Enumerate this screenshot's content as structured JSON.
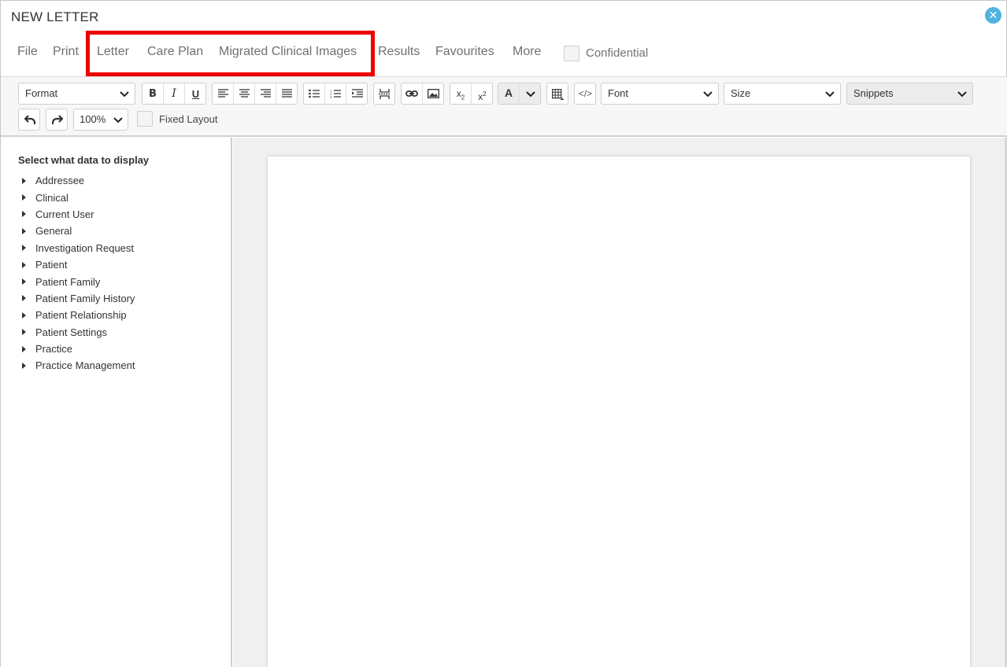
{
  "window": {
    "title": "NEW LETTER",
    "close_icon": "close-circle-icon"
  },
  "menu": {
    "items": [
      {
        "label": "File"
      },
      {
        "label": "Print"
      },
      {
        "label": "Letter"
      },
      {
        "label": "Care Plan"
      },
      {
        "label": "Migrated Clinical Images"
      },
      {
        "label": "Results"
      },
      {
        "label": "Favourites"
      },
      {
        "label": "More"
      }
    ],
    "confidential_label": "Confidential",
    "confidential_checked": false
  },
  "toolbar": {
    "format_label": "Format",
    "bold": "B",
    "italic": "I",
    "underline": "U",
    "font_color": "A",
    "font_label": "Font",
    "size_label": "Size",
    "snippets_label": "Snippets",
    "zoom_value": "100%",
    "fixed_layout_label": "Fixed Layout",
    "fixed_layout_checked": false
  },
  "sidebar": {
    "heading": "Select what data to display",
    "items": [
      {
        "label": "Addressee"
      },
      {
        "label": "Clinical"
      },
      {
        "label": "Current User"
      },
      {
        "label": "General"
      },
      {
        "label": "Investigation Request"
      },
      {
        "label": "Patient"
      },
      {
        "label": "Patient Family"
      },
      {
        "label": "Patient Family History"
      },
      {
        "label": "Patient Relationship"
      },
      {
        "label": "Patient Settings"
      },
      {
        "label": "Practice"
      },
      {
        "label": "Practice Management"
      }
    ]
  },
  "colors": {
    "accent": "#4fb3e0",
    "highlight": "#ee0000"
  }
}
